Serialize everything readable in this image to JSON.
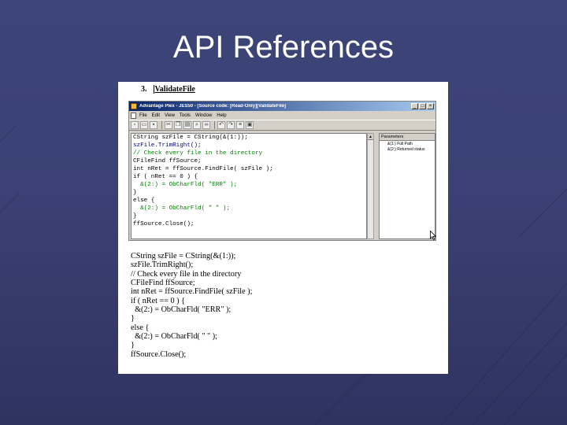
{
  "slide": {
    "title": "API References"
  },
  "document": {
    "step_number": "3.",
    "step_name": "ValidateFile"
  },
  "app_window": {
    "title": "Advantage Plex - JES50 - [Source code: [Read-Only][ValidateFile]",
    "window_buttons": [
      "_",
      "□",
      "×"
    ],
    "menu": [
      "File",
      "Edit",
      "View",
      "Tools",
      "Window",
      "Help"
    ],
    "toolbar_icons": [
      "new-icon",
      "open-icon",
      "save-icon",
      "cut-icon",
      "copy-icon",
      "paste-icon",
      "find-icon",
      "binoculars-icon",
      "undo-icon",
      "redo-icon",
      "list-icon",
      "properties-icon"
    ],
    "code_lines": [
      "CString szFile = CString(&(1:));",
      "szFile.TrimRight();",
      "// Check every file in the directory",
      "CFileFind ffSource;",
      "int nRet = ffSource.FindFile( szFile );",
      "if ( nRet == 0 ) {",
      "  &(2:) = ObCharFld( \"ERR\" );",
      "}",
      "else {",
      "  &(2:) = ObCharFld( \" \" );",
      "}",
      "ffSource.Close();"
    ],
    "parameters_header": "Parameters",
    "parameters": [
      "&(1:) Full Path",
      "&(2:) Returned status"
    ],
    "code_color": "#008000",
    "keyword_color": "#000080"
  },
  "printed_code": [
    "CString szFile = CString(&(1:));",
    "szFile.TrimRight();",
    "// Check every file in the directory",
    "CFileFind ffSource;",
    "int nRet = ffSource.FindFile( szFile );",
    "if ( nRet == 0 ) {",
    "  &(2:) = ObCharFld( \"ERR\" );",
    "}",
    "else {",
    "  &(2:) = ObCharFld( \" \" );",
    "}",
    "ffSource.Close();"
  ]
}
